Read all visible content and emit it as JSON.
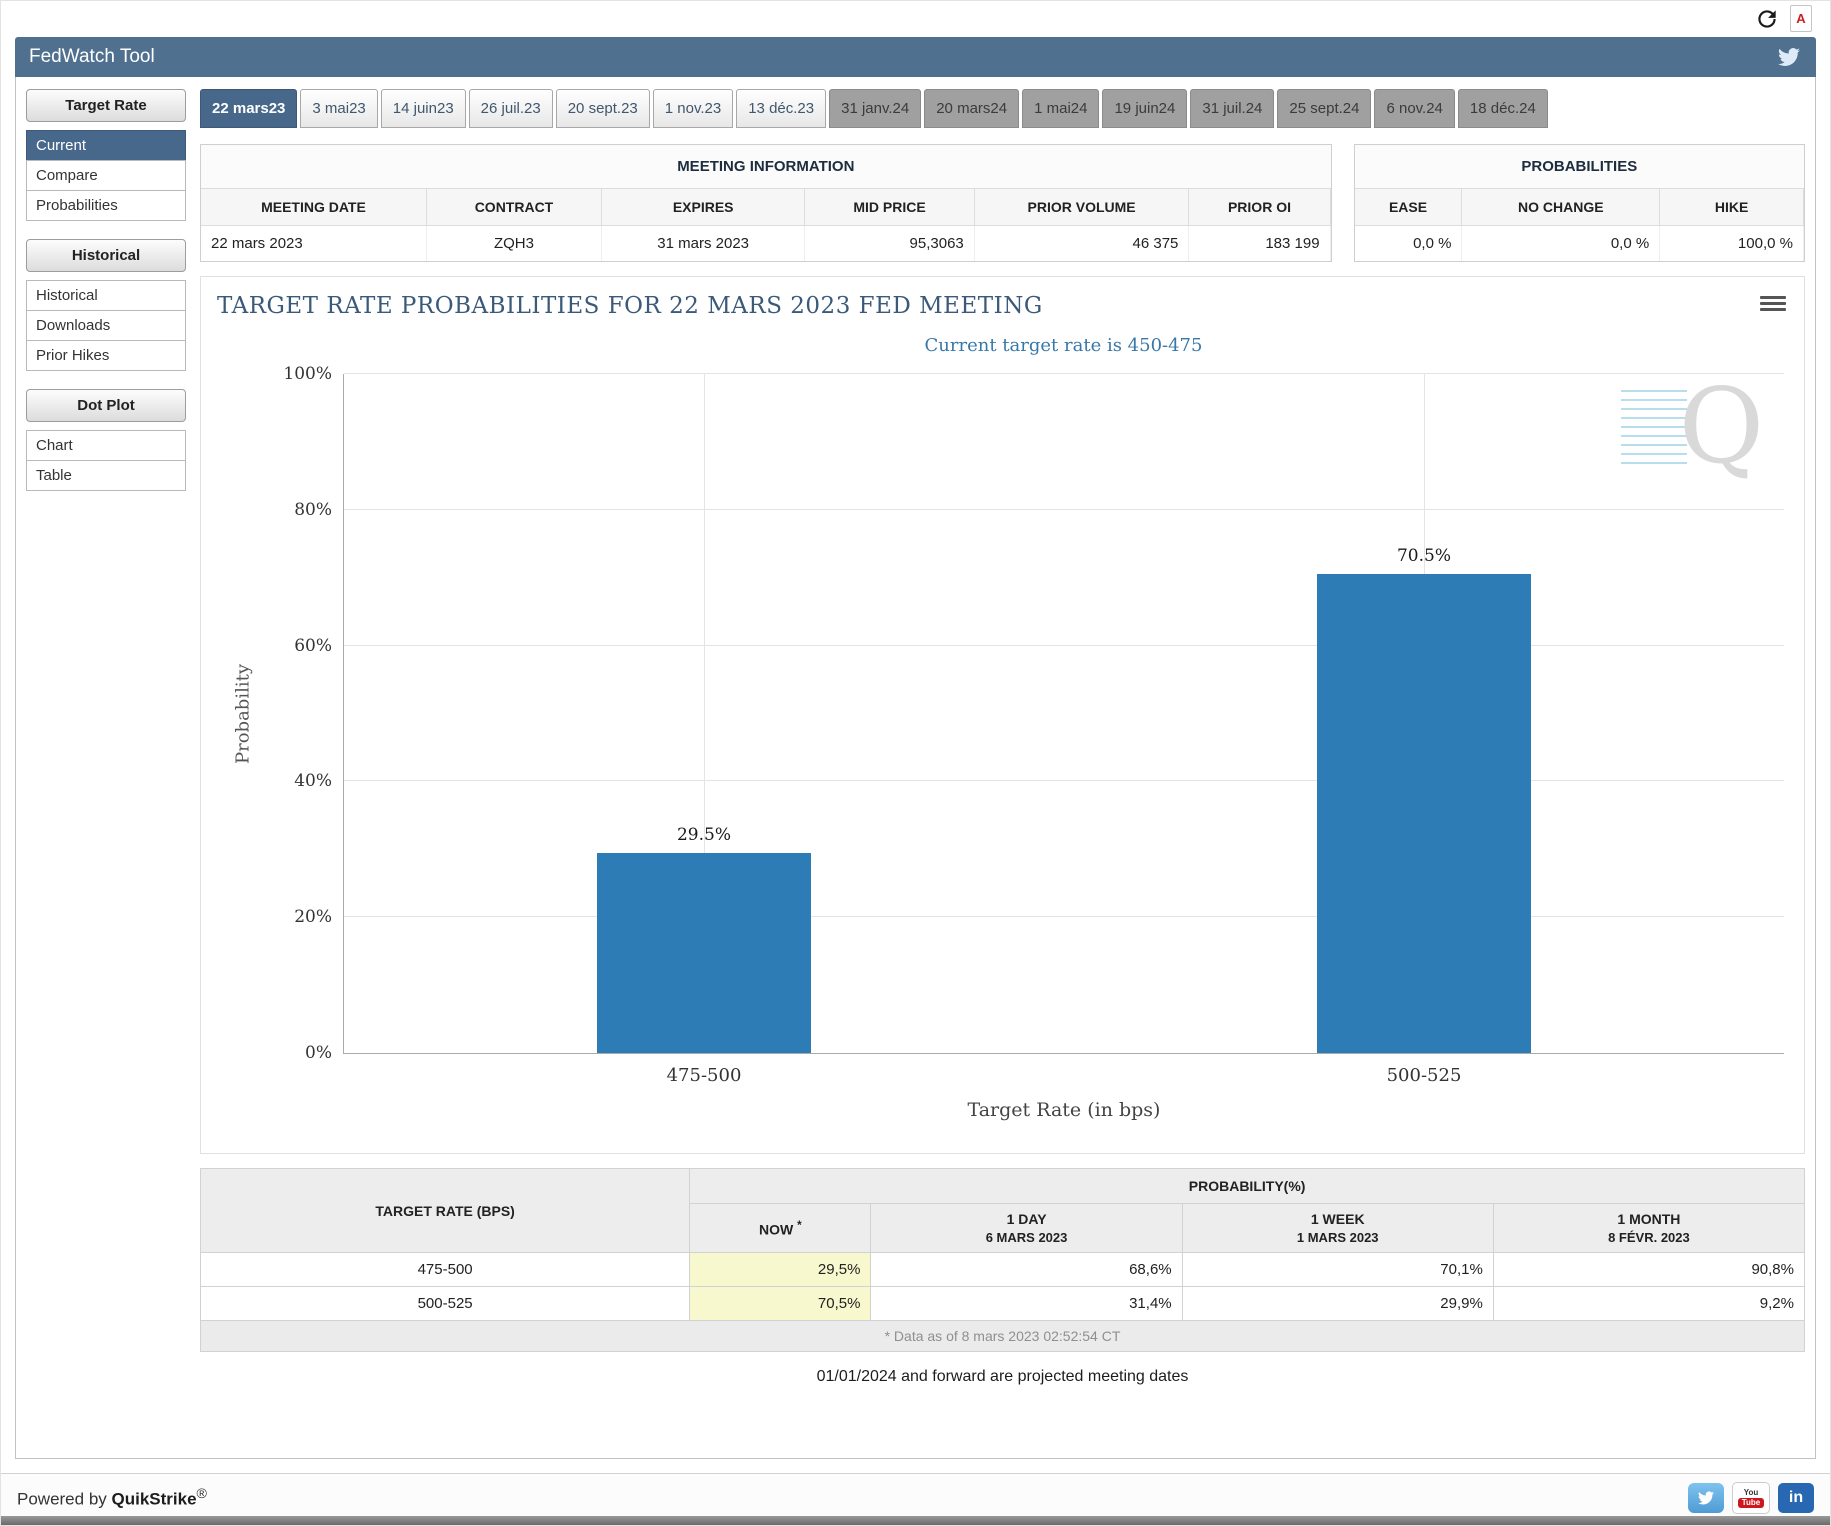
{
  "header": {
    "title": "FedWatch Tool"
  },
  "tabs": [
    {
      "label": "22 mars23",
      "state": "selected"
    },
    {
      "label": "3 mai23",
      "state": "normal"
    },
    {
      "label": "14 juin23",
      "state": "normal"
    },
    {
      "label": "26 juil.23",
      "state": "normal"
    },
    {
      "label": "20 sept.23",
      "state": "normal"
    },
    {
      "label": "1 nov.23",
      "state": "normal"
    },
    {
      "label": "13 déc.23",
      "state": "normal"
    },
    {
      "label": "31 janv.24",
      "state": "projected"
    },
    {
      "label": "20 mars24",
      "state": "projected"
    },
    {
      "label": "1 mai24",
      "state": "projected"
    },
    {
      "label": "19 juin24",
      "state": "projected"
    },
    {
      "label": "31 juil.24",
      "state": "projected"
    },
    {
      "label": "25 sept.24",
      "state": "projected"
    },
    {
      "label": "6 nov.24",
      "state": "projected"
    },
    {
      "label": "18 déc.24",
      "state": "projected"
    }
  ],
  "sidebar": {
    "sections": [
      {
        "title": "Target Rate",
        "items": [
          {
            "label": "Current",
            "selected": true
          },
          {
            "label": "Compare",
            "selected": false
          },
          {
            "label": "Probabilities",
            "selected": false
          }
        ]
      },
      {
        "title": "Historical",
        "items": [
          {
            "label": "Historical",
            "selected": false
          },
          {
            "label": "Downloads",
            "selected": false
          },
          {
            "label": "Prior Hikes",
            "selected": false
          }
        ]
      },
      {
        "title": "Dot Plot",
        "items": [
          {
            "label": "Chart",
            "selected": false
          },
          {
            "label": "Table",
            "selected": false
          }
        ]
      }
    ]
  },
  "meeting_info": {
    "title": "MEETING INFORMATION",
    "headers": [
      "MEETING DATE",
      "CONTRACT",
      "EXPIRES",
      "MID PRICE",
      "PRIOR VOLUME",
      "PRIOR OI"
    ],
    "values": [
      "22 mars 2023",
      "ZQH3",
      "31 mars 2023",
      "95,3063",
      "46 375",
      "183 199"
    ]
  },
  "probabilities_info": {
    "title": "PROBABILITIES",
    "headers": [
      "EASE",
      "NO CHANGE",
      "HIKE"
    ],
    "values": [
      "0,0 %",
      "0,0 %",
      "100,0 %"
    ]
  },
  "chart_data": {
    "type": "bar",
    "title": "TARGET RATE PROBABILITIES FOR 22 MARS 2023 FED MEETING",
    "subtitle": "Current target rate is 450-475",
    "categories": [
      "475-500",
      "500-525"
    ],
    "values": [
      29.5,
      70.5
    ],
    "value_labels": [
      "29.5%",
      "70.5%"
    ],
    "xlabel": "Target Rate (in bps)",
    "ylabel": "Probability",
    "ylim": [
      0,
      100
    ],
    "yticks": [
      0,
      20,
      40,
      60,
      80,
      100
    ],
    "grid": true,
    "legend": "none",
    "bar_color": "#2d7cb5",
    "watermark": "Q"
  },
  "prob_table": {
    "rate_header": "TARGET RATE (BPS)",
    "group_header": "PROBABILITY(%)",
    "columns": [
      {
        "label": "NOW",
        "sup": "*",
        "date": ""
      },
      {
        "label": "1 DAY",
        "date": "6 MARS 2023"
      },
      {
        "label": "1 WEEK",
        "date": "1 MARS 2023"
      },
      {
        "label": "1 MONTH",
        "date": "8 FÉVR. 2023"
      }
    ],
    "rows": [
      {
        "rate": "475-500",
        "values": [
          "29,5%",
          "68,6%",
          "70,1%",
          "90,8%"
        ]
      },
      {
        "rate": "500-525",
        "values": [
          "70,5%",
          "31,4%",
          "29,9%",
          "9,2%"
        ]
      }
    ],
    "footnote": "* Data as of 8 mars 2023 02:52:54 CT",
    "projection_note": "01/01/2024 and forward are projected meeting dates"
  },
  "top_icons": {
    "pdf_label": "A"
  },
  "footer": {
    "powered_by": "Powered by ",
    "brand": "QuikStrike",
    "reg": "®"
  }
}
